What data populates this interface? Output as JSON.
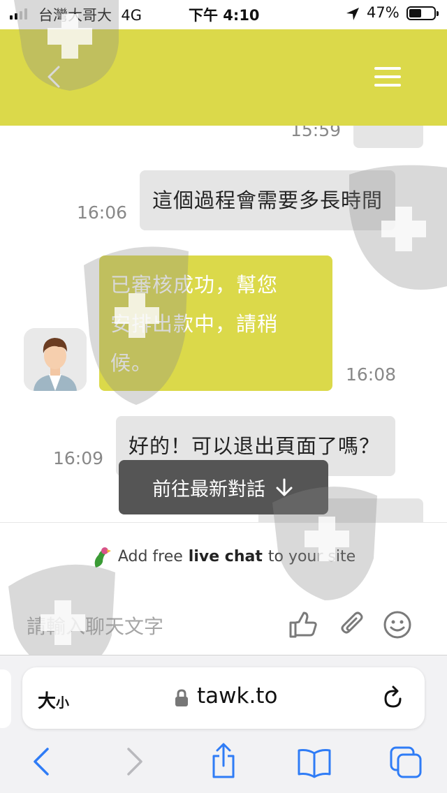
{
  "status_bar": {
    "carrier": "台灣大哥大",
    "network": "4G",
    "time": "下午 4:10",
    "battery": "47%",
    "battery_level": 0.47
  },
  "header": {
    "back_icon": "chevron-left-icon",
    "menu_icon": "hamburger-menu-icon",
    "color": "#dbd94a"
  },
  "messages": [
    {
      "sender": "visitor",
      "text": "",
      "time": "15:59"
    },
    {
      "sender": "visitor",
      "text": "這個過程會需要多長時間",
      "time": "16:06"
    },
    {
      "sender": "agent",
      "lines": [
        "已審核成功，幫您",
        "安排出款中，請稍",
        "候。"
      ],
      "time": "16:08"
    },
    {
      "sender": "visitor",
      "text": "好的！可以退出頁面了嗎？",
      "time": "16:09"
    }
  ],
  "jump_button": {
    "label": "前往最新對話"
  },
  "branding": {
    "prefix": "Add free",
    "bold": "live chat",
    "suffix": "to your site"
  },
  "composer": {
    "placeholder": "請輸入聊天文字"
  },
  "safari": {
    "text_size": "大",
    "text_size_small": "小",
    "domain": "tawk.to"
  },
  "colors": {
    "accent": "#dbd94a",
    "bubble_gray": "#e5e5e5",
    "ios_blue": "#2f7cf6"
  }
}
